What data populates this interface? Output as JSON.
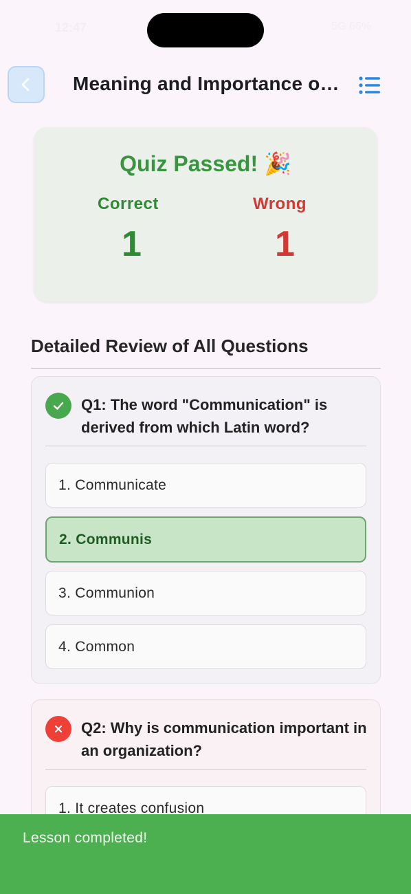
{
  "status_bar": {
    "time": "12:47",
    "right": "5G 66%"
  },
  "header": {
    "back_icon": "chevron-left-icon",
    "title": "Meaning and Importance of Communication",
    "menu_icon": "list-icon"
  },
  "result": {
    "title": "Quiz Passed! 🎉",
    "correct_label": "Correct",
    "correct_value": "1",
    "wrong_label": "Wrong",
    "wrong_value": "1"
  },
  "review": {
    "section_title": "Detailed Review of All Questions",
    "questions": [
      {
        "status": "correct",
        "text": "Q1: The word \"Communication\" is derived from which Latin word?",
        "options": [
          "1. Communicate",
          "2. Communis",
          "3. Communion",
          "4. Common"
        ],
        "selected_index": 1
      },
      {
        "status": "wrong",
        "text": "Q2: Why is communication important in an organization?",
        "options": [
          "1. It creates confusion"
        ]
      }
    ]
  },
  "toast": {
    "message": "Lesson completed!"
  },
  "colors": {
    "success": "#4caf50",
    "correct_text": "#2f8a34",
    "wrong_text": "#d13a32",
    "accent_blue": "#2a86e0"
  }
}
